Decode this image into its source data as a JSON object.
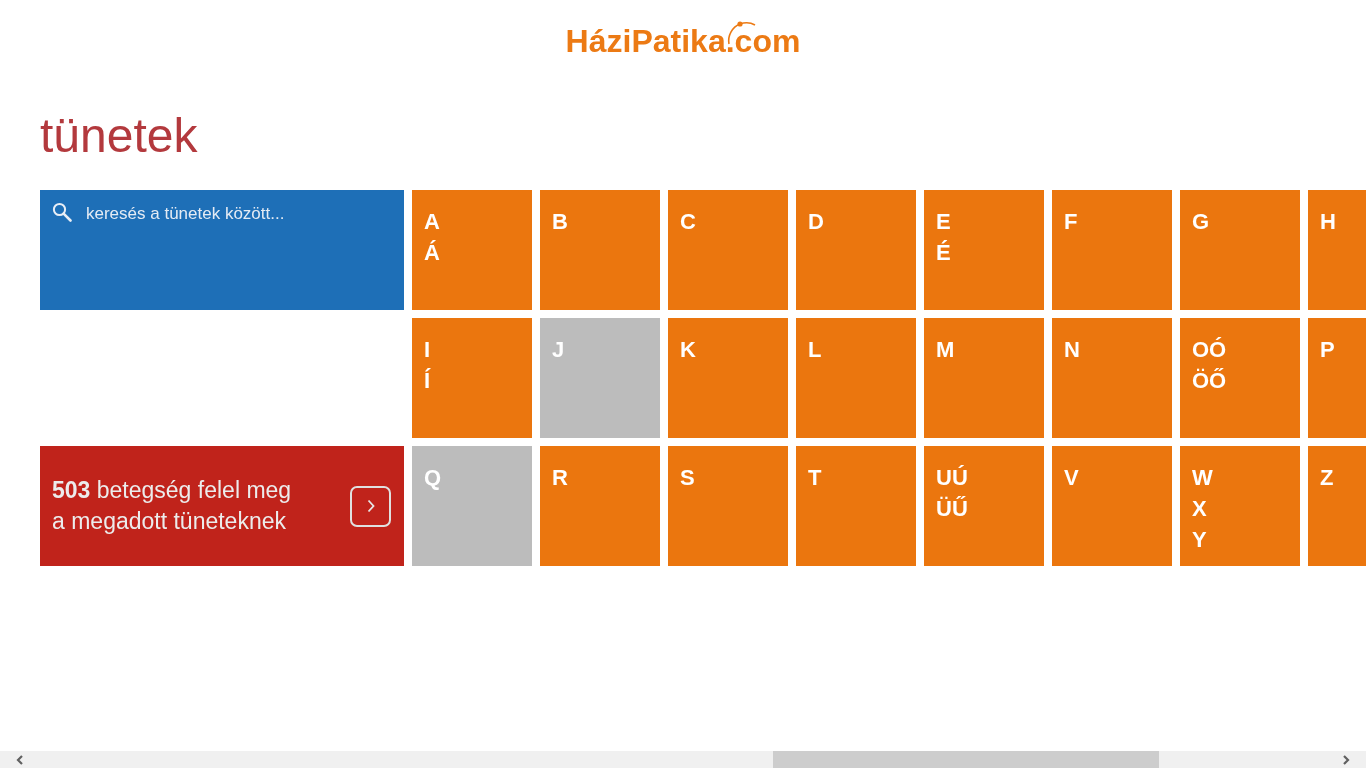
{
  "header": {
    "logo": "HáziPatika.com"
  },
  "page_title": "tünetek",
  "search": {
    "placeholder": "keresés a tünetek között..."
  },
  "results": {
    "text": "**503** betegség felel meg a megadott tüneteknek"
  },
  "letter_tiles": [
    {
      "lines": [
        "A",
        "Á"
      ],
      "disabled": false
    },
    {
      "lines": [
        "B"
      ],
      "disabled": false
    },
    {
      "lines": [
        "C"
      ],
      "disabled": false
    },
    {
      "lines": [
        "D"
      ],
      "disabled": false
    },
    {
      "lines": [
        "E",
        "É"
      ],
      "disabled": false
    },
    {
      "lines": [
        "F"
      ],
      "disabled": false
    },
    {
      "lines": [
        "G"
      ],
      "disabled": false
    },
    {
      "lines": [
        "H"
      ],
      "disabled": false
    },
    {
      "lines": [
        "I",
        "Í"
      ],
      "disabled": false
    },
    {
      "lines": [
        "J"
      ],
      "disabled": true
    },
    {
      "lines": [
        "K"
      ],
      "disabled": false
    },
    {
      "lines": [
        "L"
      ],
      "disabled": false
    },
    {
      "lines": [
        "M"
      ],
      "disabled": false
    },
    {
      "lines": [
        "N"
      ],
      "disabled": false
    },
    {
      "lines": [
        "OÓ",
        "ÖŐ"
      ],
      "disabled": false
    },
    {
      "lines": [
        "P"
      ],
      "disabled": false
    },
    {
      "lines": [
        "Q"
      ],
      "disabled": true
    },
    {
      "lines": [
        "R"
      ],
      "disabled": false
    },
    {
      "lines": [
        "S"
      ],
      "disabled": false
    },
    {
      "lines": [
        "T"
      ],
      "disabled": false
    },
    {
      "lines": [
        "UÚ",
        "ÜŰ"
      ],
      "disabled": false
    },
    {
      "lines": [
        "V"
      ],
      "disabled": false
    },
    {
      "lines": [
        "W",
        "X",
        "Y"
      ],
      "disabled": false
    },
    {
      "lines": [
        "Z"
      ],
      "disabled": false
    }
  ]
}
